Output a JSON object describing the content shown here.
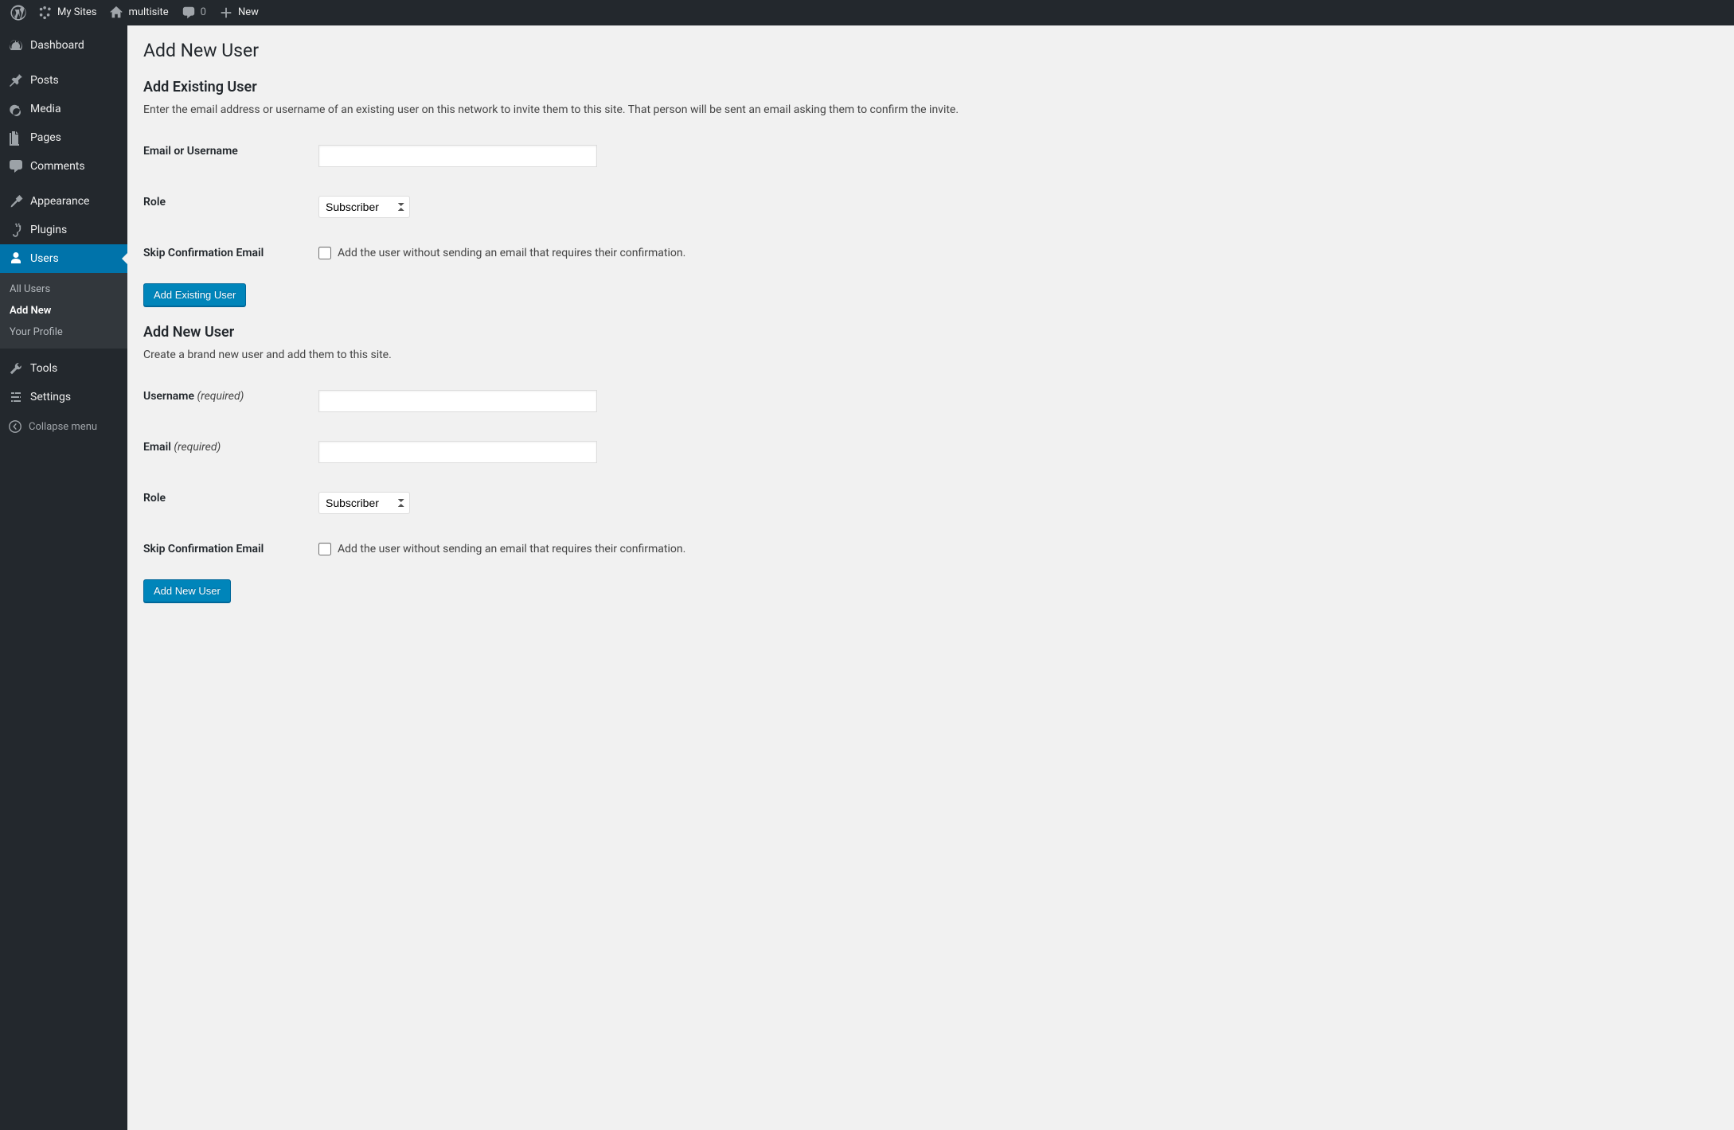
{
  "adminbar": {
    "mysites_label": "My Sites",
    "site_name": "multisite",
    "comments_count": "0",
    "new_label": "New"
  },
  "sidebar": {
    "dashboard": "Dashboard",
    "posts": "Posts",
    "media": "Media",
    "pages": "Pages",
    "comments": "Comments",
    "appearance": "Appearance",
    "plugins": "Plugins",
    "users": "Users",
    "users_sub": {
      "all": "All Users",
      "add": "Add New",
      "profile": "Your Profile"
    },
    "tools": "Tools",
    "settings": "Settings",
    "collapse": "Collapse menu"
  },
  "page": {
    "title": "Add New User",
    "existing": {
      "heading": "Add Existing User",
      "desc": "Enter the email address or username of an existing user on this network to invite them to this site. That person will be sent an email asking them to confirm the invite.",
      "email_label": "Email or Username",
      "role_label": "Role",
      "role_value": "Subscriber",
      "skip_label": "Skip Confirmation Email",
      "skip_desc": "Add the user without sending an email that requires their confirmation.",
      "submit": "Add Existing User"
    },
    "newuser": {
      "heading": "Add New User",
      "desc": "Create a brand new user and add them to this site.",
      "username_label": "Username",
      "email_label": "Email",
      "required": "(required)",
      "role_label": "Role",
      "role_value": "Subscriber",
      "skip_label": "Skip Confirmation Email",
      "skip_desc": "Add the user without sending an email that requires their confirmation.",
      "submit": "Add New User"
    }
  }
}
